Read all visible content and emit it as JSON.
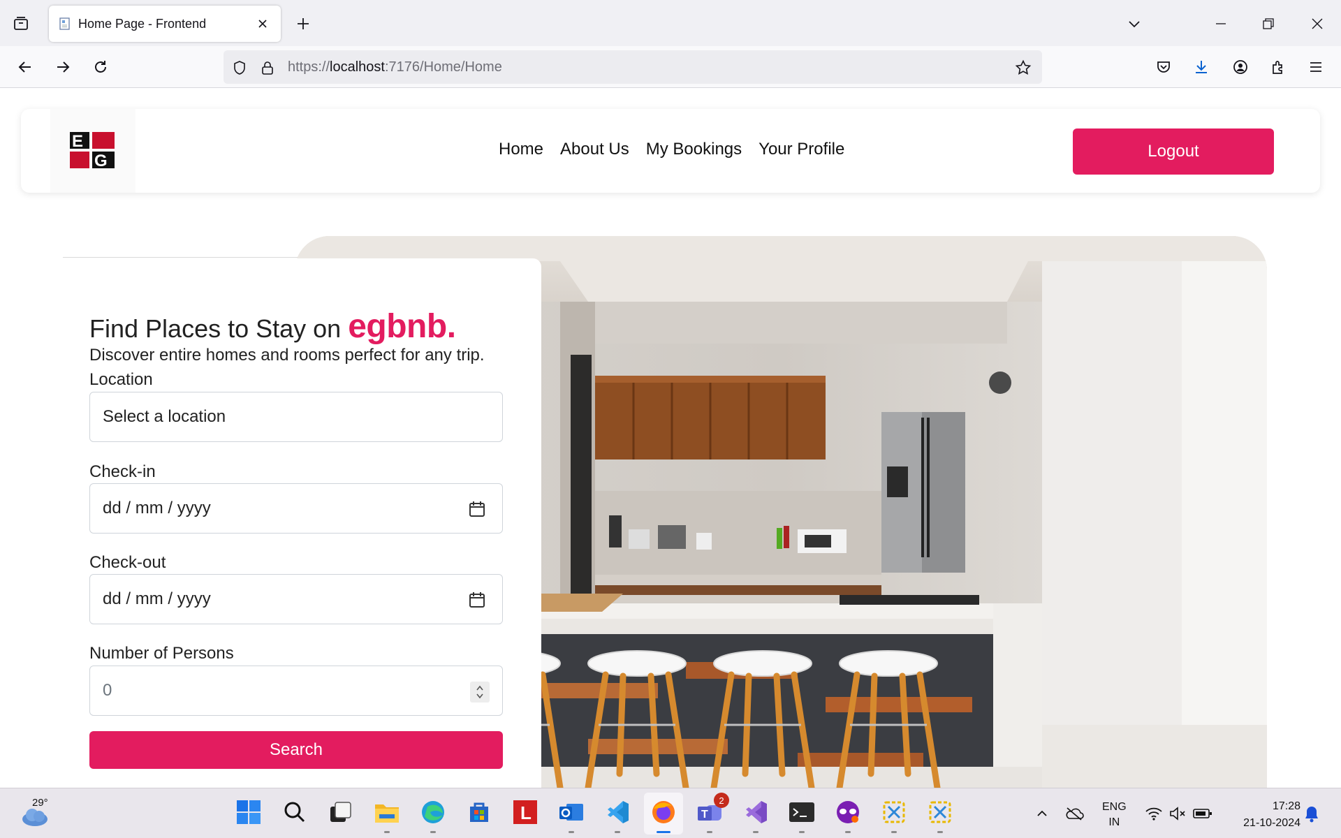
{
  "browser": {
    "tab_title": "Home Page - Frontend",
    "url_prefix": "https://",
    "url_host": "localhost",
    "url_rest": ":7176/Home/Home"
  },
  "site": {
    "nav": [
      "Home",
      "About Us",
      "My Bookings",
      "Your Profile"
    ],
    "logout_label": "Logout",
    "logo_letters": "EG"
  },
  "search": {
    "headline": "Find Places to Stay on",
    "brand": "egbnb.",
    "subheading": "Discover entire homes and rooms perfect for any trip.",
    "location_label": "Location",
    "location_value": "Select a location",
    "checkin_label": "Check-in",
    "checkin_placeholder": "dd / mm / yyyy",
    "checkout_label": "Check-out",
    "checkout_placeholder": "dd / mm / yyyy",
    "persons_label": "Number of Persons",
    "persons_value": "0",
    "search_label": "Search"
  },
  "taskbar": {
    "temperature": "29°",
    "teams_badge": "2",
    "lang_line1": "ENG",
    "lang_line2": "IN",
    "time": "17:28",
    "date": "21-10-2024"
  },
  "colors": {
    "brand_accent": "#e31c5f",
    "chrome_bg": "#f0f0f4",
    "taskbar_bg": "#e9e6ec"
  }
}
